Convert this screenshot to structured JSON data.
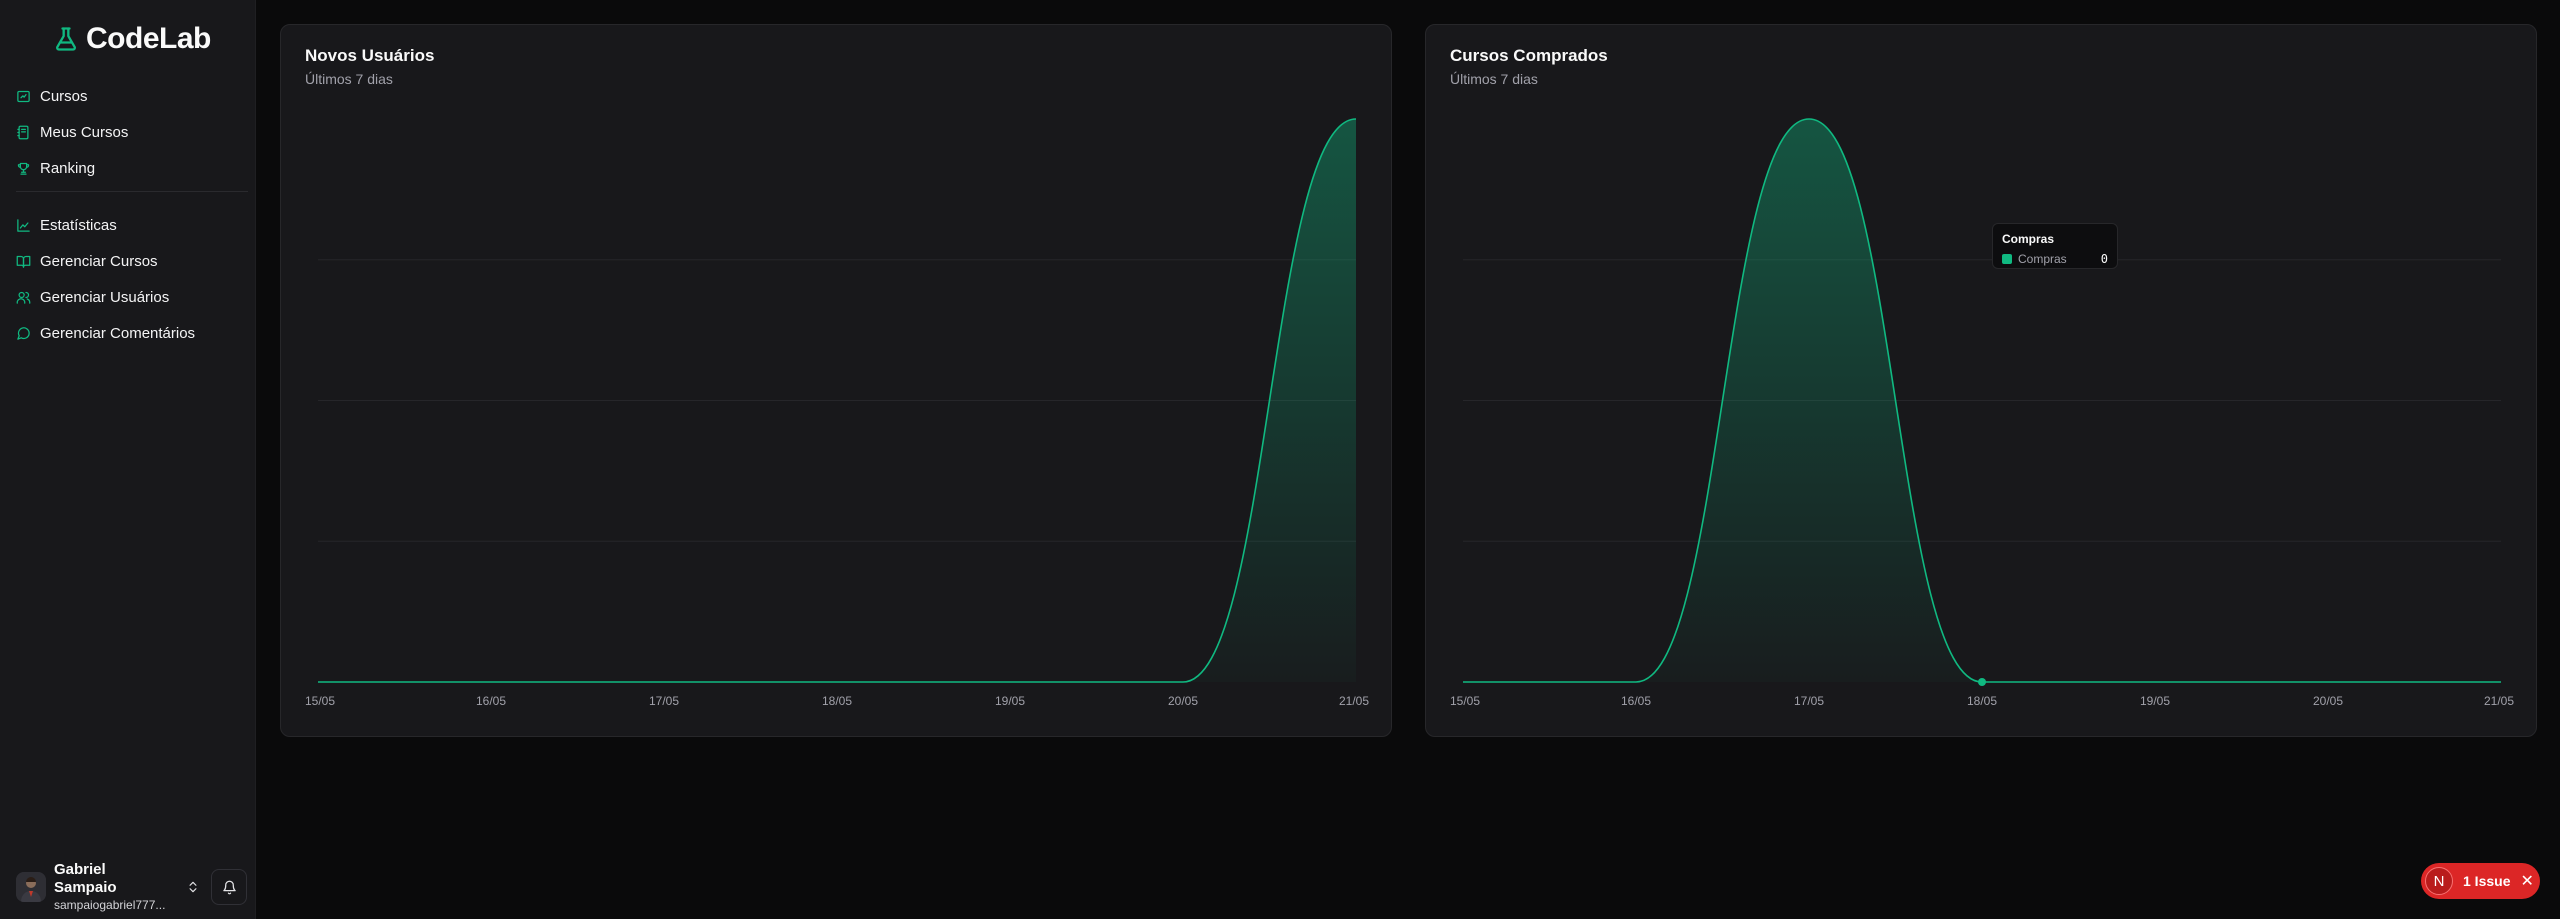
{
  "app": {
    "name": "CodeLab"
  },
  "sidebar": {
    "primary": [
      {
        "label": "Cursos",
        "icon": "presentation-icon"
      },
      {
        "label": "Meus Cursos",
        "icon": "notebook-icon"
      },
      {
        "label": "Ranking",
        "icon": "trophy-icon"
      }
    ],
    "admin": [
      {
        "label": "Estatísticas",
        "icon": "chart-icon"
      },
      {
        "label": "Gerenciar Cursos",
        "icon": "book-open-icon"
      },
      {
        "label": "Gerenciar Usuários",
        "icon": "users-icon"
      },
      {
        "label": "Gerenciar Comentários",
        "icon": "message-circle-icon"
      }
    ],
    "user": {
      "name": "Gabriel Sampaio",
      "email": "sampaiogabriel777..."
    }
  },
  "colors": {
    "accent": "#10b981",
    "background": "#0a0a0b",
    "card": "#18181b",
    "danger": "#dc2626"
  },
  "cards": [
    {
      "title": "Novos Usuários",
      "subtitle": "Últimos 7 dias"
    },
    {
      "title": "Cursos Comprados",
      "subtitle": "Últimos 7 dias"
    }
  ],
  "tooltip": {
    "title": "Compras",
    "label": "Compras",
    "value": "0"
  },
  "chart_data": [
    {
      "type": "area",
      "title": "Novos Usuários",
      "categories": [
        "15/05",
        "16/05",
        "17/05",
        "18/05",
        "19/05",
        "20/05",
        "21/05"
      ],
      "series": [
        {
          "values": [
            0,
            0,
            0,
            0,
            0,
            0,
            1
          ]
        }
      ],
      "ylim": [
        0,
        1
      ],
      "grid": true,
      "curve": "smooth"
    },
    {
      "type": "area",
      "title": "Cursos Comprados",
      "categories": [
        "15/05",
        "16/05",
        "17/05",
        "18/05",
        "19/05",
        "20/05",
        "21/05"
      ],
      "series": [
        {
          "name": "Compras",
          "values": [
            0,
            0,
            1,
            0,
            0,
            0,
            0
          ]
        }
      ],
      "ylim": [
        0,
        1
      ],
      "grid": true,
      "curve": "smooth",
      "highlighted_category": "18/05"
    }
  ],
  "issue_badge": {
    "letter": "N",
    "text": "1 Issue",
    "close": "✕"
  }
}
